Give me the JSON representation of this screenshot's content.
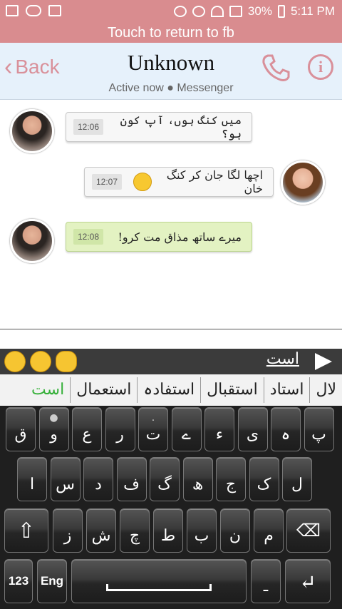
{
  "status": {
    "battery": "30%",
    "time": "5:11 PM"
  },
  "return_bar": "Touch to return to fb",
  "header": {
    "back": "Back",
    "title": "Unknown",
    "subtitle": "Active now ● Messenger"
  },
  "messages": [
    {
      "time": "12:06",
      "text": "میں کنگ ہوں، آپ کون ہو؟"
    },
    {
      "time": "12:07",
      "text": "اچھا لگا جان کر کنگ خان"
    },
    {
      "time": "12:08",
      "text": "میرے ساتھ مذاق مت کرو!"
    }
  ],
  "keyboard": {
    "prediction": "است",
    "suggestions": [
      "است",
      "استعمال",
      "استفادہ",
      "استقبال",
      "استاد",
      "لال"
    ],
    "row1": [
      {
        "m": "ق"
      },
      {
        "m": "و",
        "a": "●"
      },
      {
        "m": "ع"
      },
      {
        "m": "ر"
      },
      {
        "m": "ت",
        "a": "."
      },
      {
        "m": "ے"
      },
      {
        "m": "ء"
      },
      {
        "m": "ی"
      },
      {
        "m": "ہ"
      },
      {
        "m": "پ"
      }
    ],
    "row2": [
      {
        "m": "ا"
      },
      {
        "m": "س"
      },
      {
        "m": "د"
      },
      {
        "m": "ف"
      },
      {
        "m": "گ"
      },
      {
        "m": "ھ"
      },
      {
        "m": "ج"
      },
      {
        "m": "ک"
      },
      {
        "m": "ل"
      }
    ],
    "row3": [
      {
        "m": "ز"
      },
      {
        "m": "ش"
      },
      {
        "m": "چ"
      },
      {
        "m": "ط"
      },
      {
        "m": "ب"
      },
      {
        "m": "ن"
      },
      {
        "m": "م"
      }
    ],
    "num_key": "123",
    "lang_key": "Eng",
    "dash_key": "ـ"
  },
  "colors": {
    "status": "#d98c8f",
    "accent": "#d9909a",
    "header_bg": "#e6f1fb",
    "green_bubble": "#e3f2c2",
    "suggestion_active": "#36b03a"
  }
}
